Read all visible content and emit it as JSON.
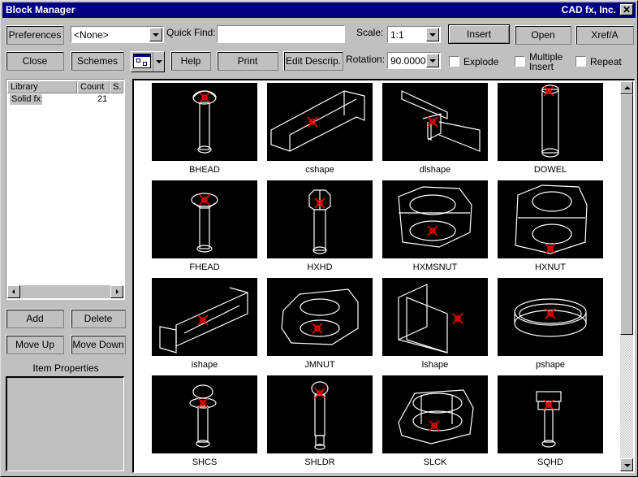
{
  "window": {
    "title": "Block Manager",
    "company": "CAD fx, Inc.",
    "close_glyph": "✕"
  },
  "toolbar": {
    "preferences_label": "Preferences",
    "scheme_combo_value": "<None>",
    "quick_find_label": "Quick Find:",
    "quick_find_value": "",
    "scale_label": "Scale:",
    "scale_value": "1:1",
    "insert_label": "Insert",
    "open_label": "Open",
    "xref_label": "Xref/A",
    "close_label": "Close",
    "schemes_label": "Schemes",
    "view_mode_icon": "thumbnail-view-icon",
    "help_label": "Help",
    "print_label": "Print",
    "edit_descrip_label": "Edit Descrip.",
    "rotation_label": "Rotation:",
    "rotation_value": "90.00000",
    "explode_label": "Explode",
    "explode_checked": false,
    "multiple_insert_label_1": "Multiple",
    "multiple_insert_label_2": "Insert",
    "multiple_insert_checked": false,
    "repeat_label": "Repeat",
    "repeat_checked": false
  },
  "library_list": {
    "columns": [
      "Library",
      "Count",
      "S."
    ],
    "rows": [
      {
        "library": "Solid fx",
        "count": "21",
        "s": ""
      }
    ]
  },
  "library_buttons": {
    "add_label": "Add",
    "delete_label": "Delete",
    "move_up_label": "Move Up",
    "move_down_label": "Move Down"
  },
  "item_properties": {
    "heading": "Item Properties"
  },
  "blocks": [
    {
      "name": "BHEAD",
      "shape": "bolt-dome"
    },
    {
      "name": "cshape",
      "shape": "channel"
    },
    {
      "name": "dlshape",
      "shape": "double-angle"
    },
    {
      "name": "DOWEL",
      "shape": "dowel"
    },
    {
      "name": "FHEAD",
      "shape": "bolt-flat"
    },
    {
      "name": "HXHD",
      "shape": "bolt-hex"
    },
    {
      "name": "HXMSNUT",
      "shape": "hexnut-low"
    },
    {
      "name": "HXNUT",
      "shape": "hexnut"
    },
    {
      "name": "ishape",
      "shape": "ibeam"
    },
    {
      "name": "JMNUT",
      "shape": "jamnut"
    },
    {
      "name": "lshape",
      "shape": "angle"
    },
    {
      "name": "pshape",
      "shape": "pipe"
    },
    {
      "name": "SHCS",
      "shape": "bolt-socket"
    },
    {
      "name": "SHLDR",
      "shape": "bolt-shoulder"
    },
    {
      "name": "SLCK",
      "shape": "slotted-nut"
    },
    {
      "name": "SQHD",
      "shape": "bolt-square"
    }
  ],
  "colors": {
    "titlebar": "#000080",
    "insertion_point": "#ff0000",
    "wireframe": "#ffffff",
    "thumbnail_bg": "#000000"
  },
  "scrollbar": {
    "position_fraction": 0.0,
    "visible_fraction": 0.66
  }
}
